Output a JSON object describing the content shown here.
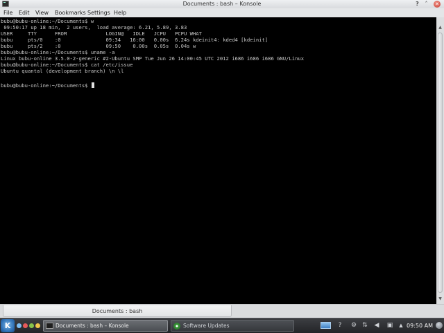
{
  "window": {
    "title": "Documents : bash – Konsole",
    "help_glyph": "?",
    "minimize_glyph": "˄",
    "close_glyph": "✕"
  },
  "menu": [
    "File",
    "Edit",
    "View",
    "Bookmarks",
    "Settings",
    "Help"
  ],
  "terminal": {
    "lines": [
      "bubu@bubu-online:~/Documents$ w",
      " 09:50:17 up 18 min,  2 users,  load average: 6.21, 5.89, 3.83",
      "USER     TTY      FROM             LOGIN@   IDLE   JCPU   PCPU WHAT",
      "bubu     pts/0    :0               09:34   16:00   0.00s  6.24s kdeinit4: kded4 [kdeinit]",
      "bubu     pts/2    :0               09:50    0.00s  0.05s  0.04s w",
      "bubu@bubu-online:~/Documents$ uname -a",
      "Linux bubu-online 3.5.0-2-generic #2-Ubuntu SMP Tue Jun 26 14:00:45 UTC 2012 i686 i686 i686 GNU/Linux",
      "bubu@bubu-online:~/Documents$ cat /etc/issue",
      "Ubuntu quantal (development branch) \\n \\l",
      "",
      "bubu@bubu-online:~/Documents$ "
    ]
  },
  "scrollbar": {
    "up_glyph": "▲",
    "down_glyph": "▼"
  },
  "tabs": [
    {
      "label": "Documents : bash"
    }
  ],
  "taskbar": {
    "tasks": [
      {
        "label": "Documents : bash – Konsole",
        "icon": "konsole-icon",
        "active": true
      },
      {
        "label": "Software Updates",
        "icon": "software-updates-icon",
        "active": false
      }
    ],
    "tray": {
      "help_glyph": "?",
      "settings_glyph": "⚙",
      "network_glyph": "⇅",
      "volume_glyph": "◀",
      "user_glyph": "▣",
      "arrow_glyph": "▲"
    },
    "clock": "09:50 AM"
  }
}
